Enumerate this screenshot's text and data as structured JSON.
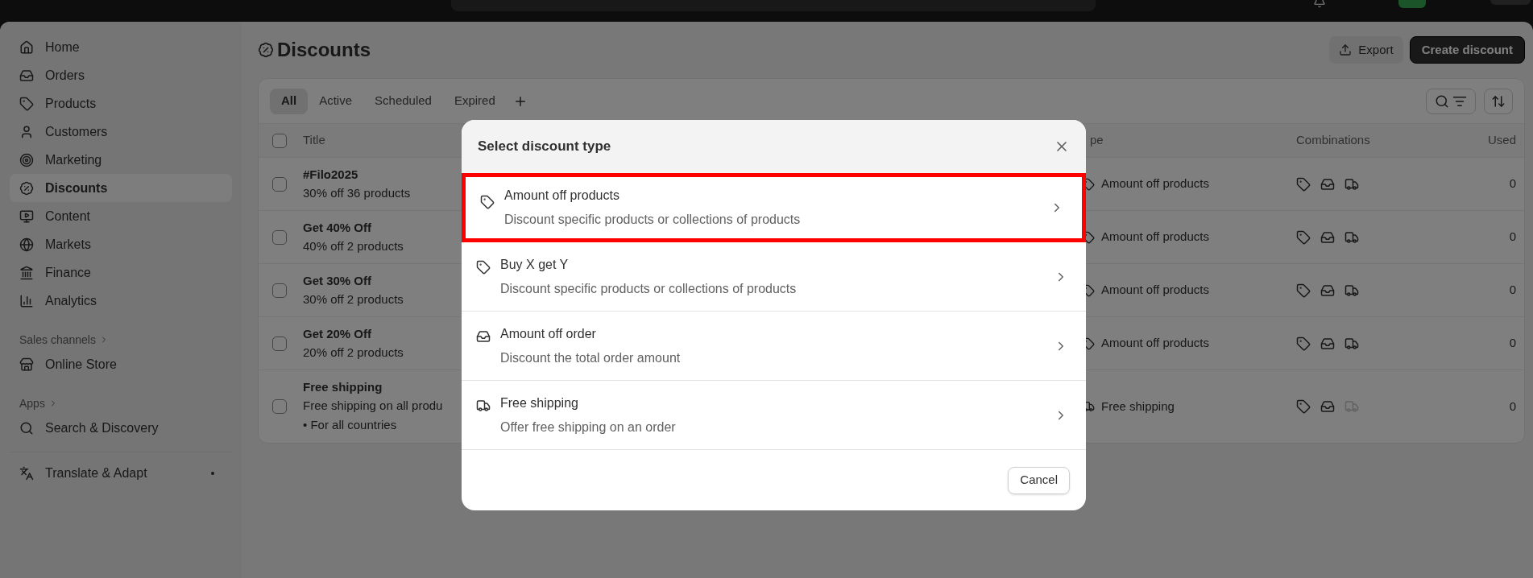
{
  "sidebar": {
    "items": [
      {
        "label": "Home",
        "selected": false
      },
      {
        "label": "Orders",
        "selected": false
      },
      {
        "label": "Products",
        "selected": false
      },
      {
        "label": "Customers",
        "selected": false
      },
      {
        "label": "Marketing",
        "selected": false
      },
      {
        "label": "Discounts",
        "selected": true
      },
      {
        "label": "Content",
        "selected": false
      },
      {
        "label": "Markets",
        "selected": false
      },
      {
        "label": "Finance",
        "selected": false
      },
      {
        "label": "Analytics",
        "selected": false
      }
    ],
    "sections": [
      {
        "title": "Sales channels",
        "items": [
          {
            "label": "Online Store"
          }
        ]
      },
      {
        "title": "Apps",
        "items": [
          {
            "label": "Search & Discovery"
          }
        ]
      }
    ],
    "pinned": [
      {
        "label": "Translate & Adapt"
      }
    ]
  },
  "page": {
    "title": "Discounts",
    "actions": [
      {
        "label": "Export",
        "kind": "secondary"
      },
      {
        "label": "Create discount",
        "kind": "primary"
      }
    ]
  },
  "tabs": [
    {
      "label": "All",
      "selected": true
    },
    {
      "label": "Active",
      "selected": false
    },
    {
      "label": "Scheduled",
      "selected": false
    },
    {
      "label": "Expired",
      "selected": false
    }
  ],
  "table": {
    "select_all": {
      "checked": false
    },
    "columns": [
      "Title",
      "pe",
      "Combinations",
      "Used"
    ],
    "rows": [
      {
        "checked": false,
        "title": "#Filo2025",
        "summary": "30% off 36 products",
        "type": "Amount off products",
        "kind": "product",
        "combinations": {
          "products": true,
          "orders": true,
          "shipping": true
        },
        "used": "0"
      },
      {
        "checked": false,
        "title": "Get 40% Off",
        "summary": "40% off 2 products",
        "type": "Amount off products",
        "kind": "product",
        "combinations": {
          "products": true,
          "orders": true,
          "shipping": true
        },
        "used": "0"
      },
      {
        "checked": false,
        "title": "Get 30% Off",
        "summary": "30% off 2 products",
        "type": "Amount off products",
        "kind": "product",
        "combinations": {
          "products": true,
          "orders": true,
          "shipping": true
        },
        "used": "0"
      },
      {
        "checked": false,
        "title": "Get 20% Off",
        "summary": "20% off 2 products",
        "type": "Amount off products",
        "kind": "product",
        "combinations": {
          "products": true,
          "orders": true,
          "shipping": true
        },
        "used": "0"
      },
      {
        "checked": false,
        "title": "Free shipping",
        "summary": "Free shipping on all produ",
        "details": [
          "• For all countries"
        ],
        "type": "Free shipping",
        "kind": "shipping",
        "combinations": {
          "products": true,
          "orders": true,
          "shipping": false
        },
        "used": "0"
      }
    ]
  },
  "modal": {
    "title": "Select discount type",
    "options": [
      {
        "title": "Amount off products",
        "description": "Discount specific products or collections of products",
        "kind": "product",
        "highlighted": true
      },
      {
        "title": "Buy X get Y",
        "description": "Discount specific products or collections of products",
        "kind": "product",
        "highlighted": false
      },
      {
        "title": "Amount off order",
        "description": "Discount the total order amount",
        "kind": "order",
        "highlighted": false
      },
      {
        "title": "Free shipping",
        "description": "Offer free shipping on an order",
        "kind": "shipping",
        "highlighted": false
      }
    ],
    "cancel": "Cancel"
  }
}
